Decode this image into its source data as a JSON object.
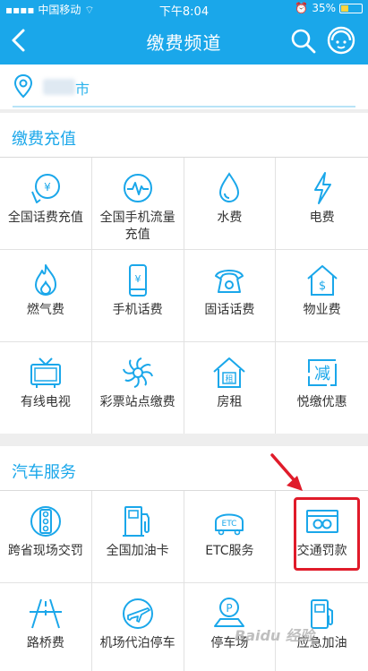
{
  "status_bar": {
    "carrier": "中国移动",
    "time": "下午8:04",
    "battery": "35%",
    "battery_level": 0.35
  },
  "nav": {
    "title": "缴费频道"
  },
  "location": {
    "city": "市"
  },
  "sections": [
    {
      "title": "缴费充值",
      "items": [
        {
          "label": "全国话费充值",
          "icon": "phone-bill-icon"
        },
        {
          "label": "全国手机流量充值",
          "icon": "data-flow-icon"
        },
        {
          "label": "水费",
          "icon": "water-drop-icon"
        },
        {
          "label": "电费",
          "icon": "lightning-icon"
        },
        {
          "label": "燃气费",
          "icon": "flame-icon"
        },
        {
          "label": "手机话费",
          "icon": "mobile-phone-icon"
        },
        {
          "label": "固话话费",
          "icon": "landline-phone-icon"
        },
        {
          "label": "物业费",
          "icon": "property-house-icon"
        },
        {
          "label": "有线电视",
          "icon": "tv-icon"
        },
        {
          "label": "彩票站点缴费",
          "icon": "lottery-icon"
        },
        {
          "label": "房租",
          "icon": "rent-house-icon"
        },
        {
          "label": "悦缴优惠",
          "icon": "discount-icon"
        }
      ]
    },
    {
      "title": "汽车服务",
      "items": [
        {
          "label": "跨省现场交罚",
          "icon": "traffic-light-icon"
        },
        {
          "label": "全国加油卡",
          "icon": "fuel-card-icon"
        },
        {
          "label": "ETC服务",
          "icon": "etc-icon"
        },
        {
          "label": "交通罚款",
          "icon": "traffic-fine-icon"
        },
        {
          "label": "路桥费",
          "icon": "road-bridge-icon"
        },
        {
          "label": "机场代泊停车",
          "icon": "airport-parking-icon"
        },
        {
          "label": "停车场",
          "icon": "parking-icon"
        },
        {
          "label": "应急加油",
          "icon": "emergency-fuel-icon"
        }
      ]
    }
  ],
  "watermark": "Baidu 经验",
  "colors": {
    "primary": "#1aa7ea",
    "highlight": "#e01b2a"
  }
}
